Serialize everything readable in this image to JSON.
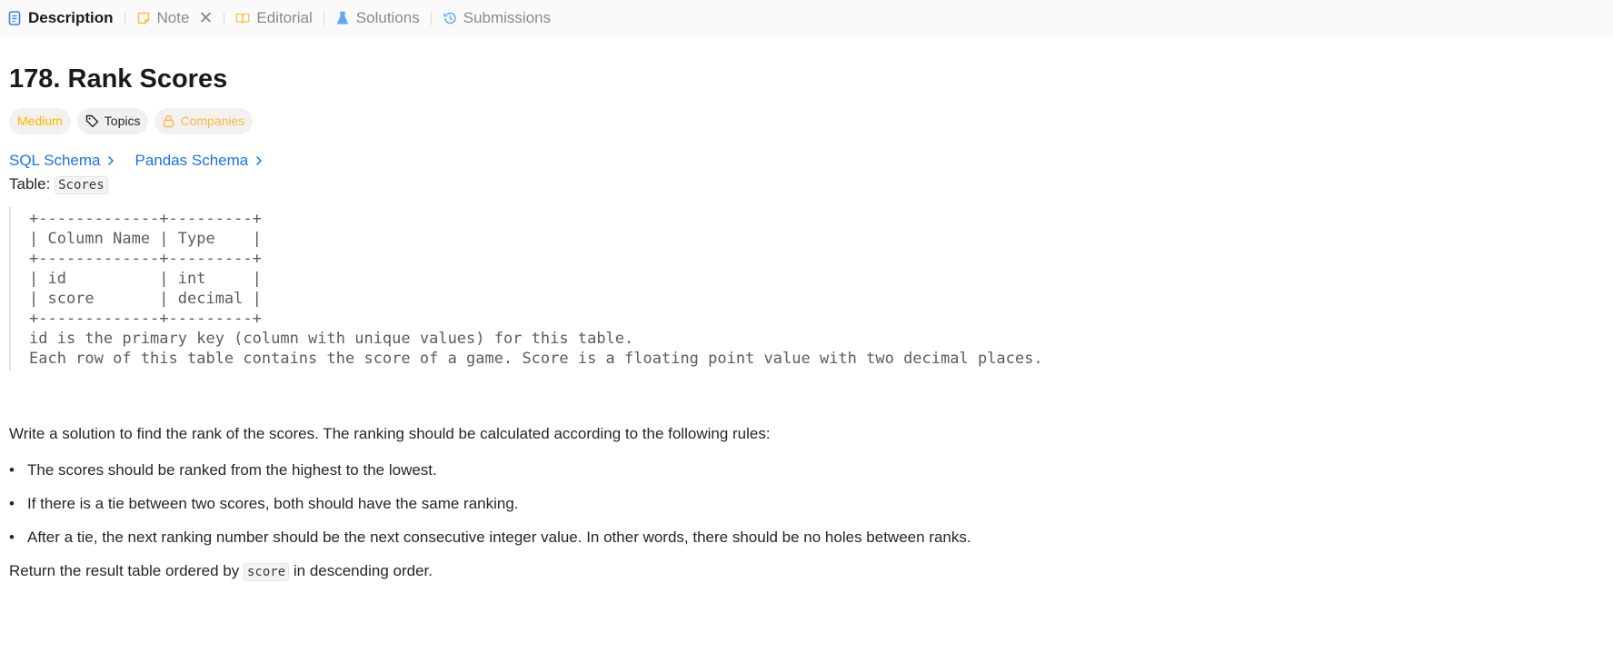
{
  "tabs": [
    {
      "label": "Description",
      "icon": "description-icon",
      "active": true
    },
    {
      "label": "Note",
      "icon": "note-icon",
      "closable": true
    },
    {
      "label": "Editorial",
      "icon": "book-icon"
    },
    {
      "label": "Solutions",
      "icon": "flask-icon"
    },
    {
      "label": "Submissions",
      "icon": "history-icon"
    }
  ],
  "problem": {
    "title": "178. Rank Scores",
    "difficulty": "Medium",
    "topics_label": "Topics",
    "companies_label": "Companies",
    "schema_links": [
      "SQL Schema",
      "Pandas Schema"
    ],
    "table_prefix": "Table: ",
    "table_name": "Scores",
    "schema_block": "+-------------+---------+\n| Column Name | Type    |\n+-------------+---------+\n| id          | int     |\n| score       | decimal |\n+-------------+---------+\nid is the primary key (column with unique values) for this table.\nEach row of this table contains the score of a game. Score is a floating point value with two decimal places.",
    "intro": "Write a solution to find the rank of the scores. The ranking should be calculated according to the following rules:",
    "rules": [
      "The scores should be ranked from the highest to the lowest.",
      "If there is a tie between two scores, both should have the same ranking.",
      "After a tie, the next ranking number should be the next consecutive integer value. In other words, there should be no holes between ranks."
    ],
    "return_prefix": "Return the result table ordered by ",
    "return_code": "score",
    "return_suffix": " in descending order."
  },
  "colors": {
    "difficulty_medium": "#ffb800",
    "link": "#1a73e8",
    "active_icon": "#3b82f6"
  }
}
